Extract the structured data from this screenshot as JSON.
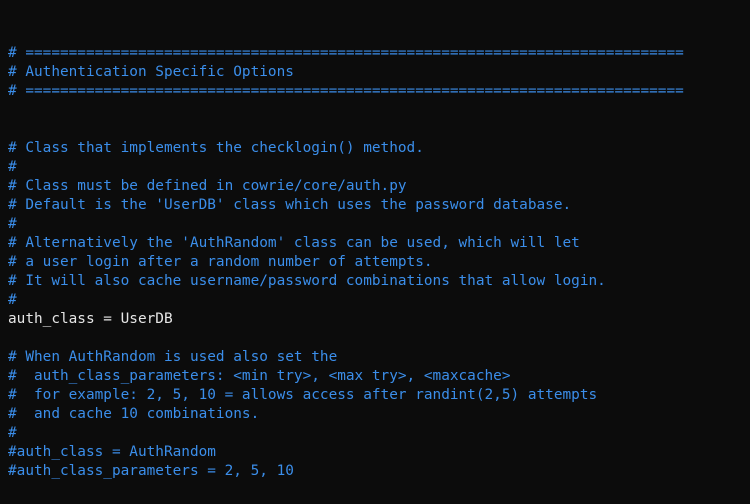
{
  "terminal": {
    "colors": {
      "background": "#0c0c0c",
      "comment": "#3b8eea",
      "text": "#e6e6e6"
    },
    "lines": [
      {
        "text": "# ============================================================================",
        "kind": "comment"
      },
      {
        "text": "# Authentication Specific Options",
        "kind": "comment"
      },
      {
        "text": "# ============================================================================",
        "kind": "comment"
      },
      {
        "text": "",
        "kind": "plain"
      },
      {
        "text": "",
        "kind": "plain"
      },
      {
        "text": "# Class that implements the checklogin() method.",
        "kind": "comment"
      },
      {
        "text": "#",
        "kind": "comment"
      },
      {
        "text": "# Class must be defined in cowrie/core/auth.py",
        "kind": "comment"
      },
      {
        "text": "# Default is the 'UserDB' class which uses the password database.",
        "kind": "comment"
      },
      {
        "text": "#",
        "kind": "comment"
      },
      {
        "text": "# Alternatively the 'AuthRandom' class can be used, which will let",
        "kind": "comment"
      },
      {
        "text": "# a user login after a random number of attempts.",
        "kind": "comment"
      },
      {
        "text": "# It will also cache username/password combinations that allow login.",
        "kind": "comment"
      },
      {
        "text": "#",
        "kind": "comment"
      },
      {
        "text": "auth_class = UserDB",
        "kind": "plain"
      },
      {
        "text": "",
        "kind": "plain"
      },
      {
        "text": "# When AuthRandom is used also set the",
        "kind": "comment"
      },
      {
        "text": "#  auth_class_parameters: <min try>, <max try>, <maxcache>",
        "kind": "comment"
      },
      {
        "text": "#  for example: 2, 5, 10 = allows access after randint(2,5) attempts",
        "kind": "comment"
      },
      {
        "text": "#  and cache 10 combinations.",
        "kind": "comment"
      },
      {
        "text": "#",
        "kind": "comment"
      },
      {
        "text": "#auth_class = AuthRandom",
        "kind": "comment"
      },
      {
        "text": "#auth_class_parameters = 2, 5, 10",
        "kind": "comment"
      }
    ]
  }
}
